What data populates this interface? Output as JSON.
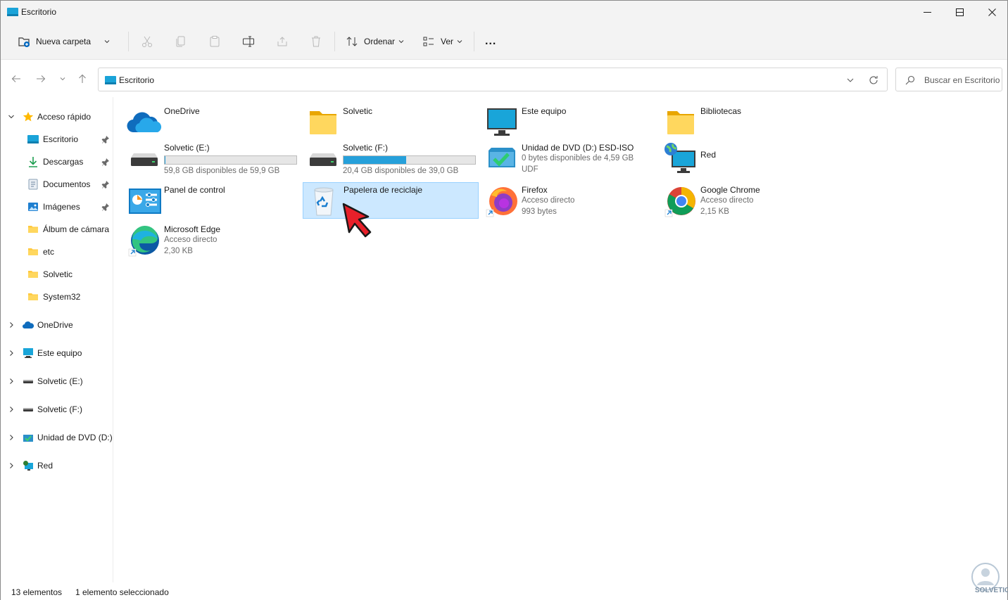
{
  "window": {
    "title": "Escritorio"
  },
  "toolbar": {
    "new_folder_label": "Nueva carpeta",
    "sort_label": "Ordenar",
    "view_label": "Ver",
    "more_label": "..."
  },
  "address": {
    "path": "Escritorio",
    "search_placeholder": "Buscar en Escritorio"
  },
  "sidebar": {
    "quick_access": "Acceso rápido",
    "items": [
      {
        "label": "Escritorio",
        "icon": "desktop-icon",
        "pinned": true
      },
      {
        "label": "Descargas",
        "icon": "download-icon",
        "pinned": true
      },
      {
        "label": "Documentos",
        "icon": "document-icon",
        "pinned": true
      },
      {
        "label": "Imágenes",
        "icon": "pictures-icon",
        "pinned": true
      },
      {
        "label": "Álbum de cámara",
        "icon": "folder-icon",
        "pinned": false
      },
      {
        "label": "etc",
        "icon": "folder-icon",
        "pinned": false
      },
      {
        "label": "Solvetic",
        "icon": "folder-icon",
        "pinned": false
      },
      {
        "label": "System32",
        "icon": "folder-icon",
        "pinned": false
      }
    ],
    "roots": [
      {
        "label": "OneDrive",
        "icon": "onedrive-icon"
      },
      {
        "label": "Este equipo",
        "icon": "computer-icon"
      },
      {
        "label": "Solvetic (E:)",
        "icon": "drive-icon"
      },
      {
        "label": "Solvetic (F:)",
        "icon": "drive-icon"
      },
      {
        "label": "Unidad de DVD (D:)",
        "icon": "dvd-icon"
      },
      {
        "label": "Red",
        "icon": "network-icon"
      }
    ]
  },
  "content": {
    "onedrive": {
      "name": "OneDrive"
    },
    "solvetic_folder": {
      "name": "Solvetic"
    },
    "este_equipo": {
      "name": "Este equipo"
    },
    "bibliotecas": {
      "name": "Bibliotecas"
    },
    "drive_e": {
      "name": "Solvetic (E:)",
      "free": "59,8 GB disponibles de 59,9 GB",
      "used_fraction": 0.002
    },
    "drive_f": {
      "name": "Solvetic (F:)",
      "free": "20,4 GB disponibles de 39,0 GB",
      "used_fraction": 0.477
    },
    "dvd": {
      "name": "Unidad de DVD (D:) ESD-ISO",
      "line1": "0 bytes disponibles de 4,59 GB",
      "line2": "UDF"
    },
    "red": {
      "name": "Red"
    },
    "panel": {
      "name": "Panel de control"
    },
    "papelera": {
      "name": "Papelera de reciclaje"
    },
    "firefox": {
      "name": "Firefox",
      "line1": "Acceso directo",
      "line2": "993 bytes"
    },
    "chrome": {
      "name": "Google Chrome",
      "line1": "Acceso directo",
      "line2": "2,15 KB"
    },
    "edge": {
      "name": "Microsoft Edge",
      "line1": "Acceso directo",
      "line2": "2,30 KB"
    }
  },
  "status": {
    "count": "13 elementos",
    "selected": "1 elemento seleccionado"
  },
  "watermark": {
    "text": "SOLVETIC"
  },
  "colors": {
    "accent": "#0067c0",
    "selection": "#cce8ff",
    "bar_fill": "#26a0da",
    "folder": "#ffc83d"
  }
}
